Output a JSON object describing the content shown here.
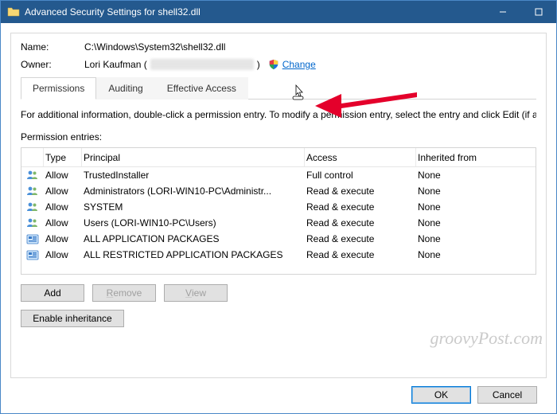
{
  "title": "Advanced Security Settings for shell32.dll",
  "labels": {
    "name": "Name:",
    "owner": "Owner:",
    "permission_entries": "Permission entries:"
  },
  "name_value": "C:\\Windows\\System32\\shell32.dll",
  "owner_name": "Lori Kaufman (",
  "owner_suffix": ")",
  "change_label": "Change",
  "tabs": {
    "permissions": "Permissions",
    "auditing": "Auditing",
    "effective": "Effective Access"
  },
  "info_text": "For additional information, double-click a permission entry. To modify a permission entry, select the entry and click Edit (if availa",
  "columns": {
    "type": "Type",
    "principal": "Principal",
    "access": "Access",
    "inherited": "Inherited from"
  },
  "entries": [
    {
      "icon": "people",
      "type": "Allow",
      "principal": "TrustedInstaller",
      "access": "Full control",
      "inherited": "None"
    },
    {
      "icon": "people",
      "type": "Allow",
      "principal": "Administrators (LORI-WIN10-PC\\Administr...",
      "access": "Read & execute",
      "inherited": "None"
    },
    {
      "icon": "people",
      "type": "Allow",
      "principal": "SYSTEM",
      "access": "Read & execute",
      "inherited": "None"
    },
    {
      "icon": "people",
      "type": "Allow",
      "principal": "Users (LORI-WIN10-PC\\Users)",
      "access": "Read & execute",
      "inherited": "None"
    },
    {
      "icon": "pkg",
      "type": "Allow",
      "principal": "ALL APPLICATION PACKAGES",
      "access": "Read & execute",
      "inherited": "None"
    },
    {
      "icon": "pkg",
      "type": "Allow",
      "principal": "ALL RESTRICTED APPLICATION PACKAGES",
      "access": "Read & execute",
      "inherited": "None"
    }
  ],
  "buttons": {
    "add": "Add",
    "remove": "Remove",
    "view": "View",
    "enable_inheritance": "Enable inheritance",
    "ok": "OK",
    "cancel": "Cancel"
  },
  "watermark": "groovyPost.com"
}
